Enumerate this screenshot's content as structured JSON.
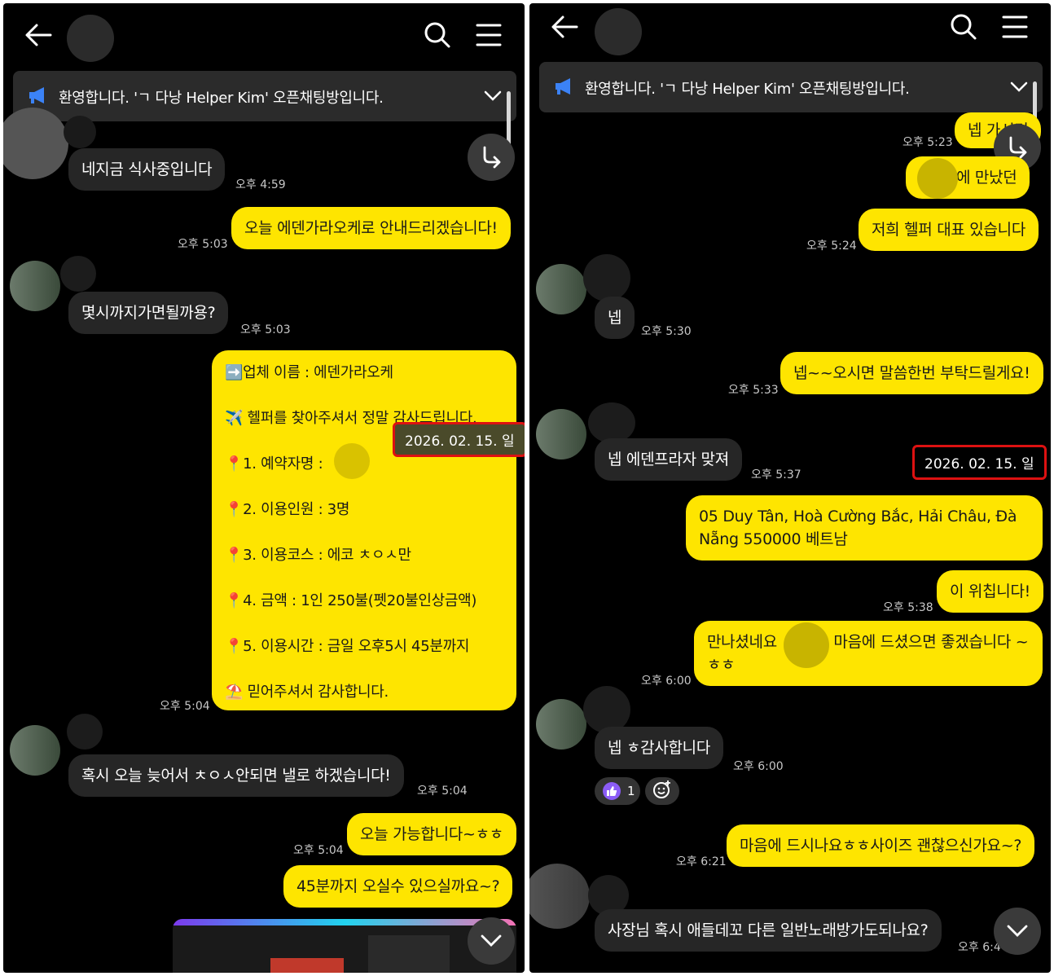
{
  "colors": {
    "my_bubble": "#fee500",
    "their_bubble": "#262626",
    "background": "#000000",
    "highlight": "#d11111"
  },
  "notice": {
    "text": "환영합니다. 'ㄱ 다낭 Helper Kim' 오픈채팅방입니다."
  },
  "left": {
    "messages": {
      "m1": {
        "text": "네지금 식사중입니다",
        "time": "오후 4:59"
      },
      "m2": {
        "text": "오늘 에덴가라오케로 안내드리겠습니다!",
        "time": "오후 5:03"
      },
      "m3": {
        "text": "몇시까지가면될까용?",
        "time": "오후 5:03"
      },
      "m4": {
        "lines": [
          "➡️업체 이름 : 에덴가라오케",
          "✈️ 헬퍼를 찾아주셔서 정말 감사드립니다.",
          "📍1. 예약자명 :",
          "📍2. 이용인원 :  3명",
          "📍3. 이용코스 :  에코 ㅊㅇㅅ만",
          "📍4. 금액 : 1인 250불(펫20불인상금액)",
          "📍5. 이용시간 : 금일 오후5시 45분까지",
          "⛱️ 믿어주셔서 감사합니다."
        ],
        "time": "오후 5:04",
        "date_badge": "2026. 02. 15. 일"
      },
      "m5": {
        "text": "혹시 오늘 늦어서 ㅊㅇㅅ안되면 낼로 하겠습니다!",
        "time": "오후 5:04"
      },
      "m6": {
        "text": "오늘 가능합니다~ㅎㅎ",
        "time": "오후 5:04"
      },
      "m7": {
        "text": "45분까지 오실수 있으실까요~?"
      }
    }
  },
  "right": {
    "messages": {
      "r1": {
        "text": "넵 가시면",
        "time": "오후 5:23"
      },
      "r2": {
        "text": "에 만났던"
      },
      "r3": {
        "text": "저희 헬퍼 대표 있습니다",
        "time": "오후 5:24"
      },
      "r4": {
        "text": "넵",
        "time": "오후 5:30"
      },
      "r5": {
        "text": "넵~~오시면 말씀한번 부탁드릴게요!",
        "time": "오후 5:33"
      },
      "r6": {
        "text": "넵 에덴프라자 맞져",
        "time": "오후 5:37"
      },
      "date_badge": "2026. 02. 15. 일",
      "r7": {
        "text": "05 Duy Tân, Hoà Cường Bắc, Hải Châu, Đà Nẵng 550000 베트남"
      },
      "r8": {
        "text": "이 위칩니다!",
        "time": "오후 5:38"
      },
      "r9": {
        "text_a": "만나셨네요",
        "text_b": "마음에 드셨으면 좋겠습니다 ~",
        "text_c": "ㅎㅎ",
        "time": "오후 6:00"
      },
      "r10": {
        "text": "넵 ㅎ감사합니다",
        "time": "오후 6:00",
        "reaction_count": "1"
      },
      "r11": {
        "text": "마음에 드시나요ㅎㅎ사이즈 괜찮으신가요~?",
        "time": "오후 6:21"
      },
      "r12": {
        "text": "사장님 혹시 애들데꼬 다른 일반노래방가도되나요?",
        "time": "오후 6:4"
      }
    }
  },
  "icons": [
    "back-arrow-icon",
    "search-icon",
    "menu-icon",
    "megaphone-icon",
    "chevron-down-icon",
    "share-arrow-icon",
    "thumbs-up-icon",
    "add-reaction-icon"
  ]
}
